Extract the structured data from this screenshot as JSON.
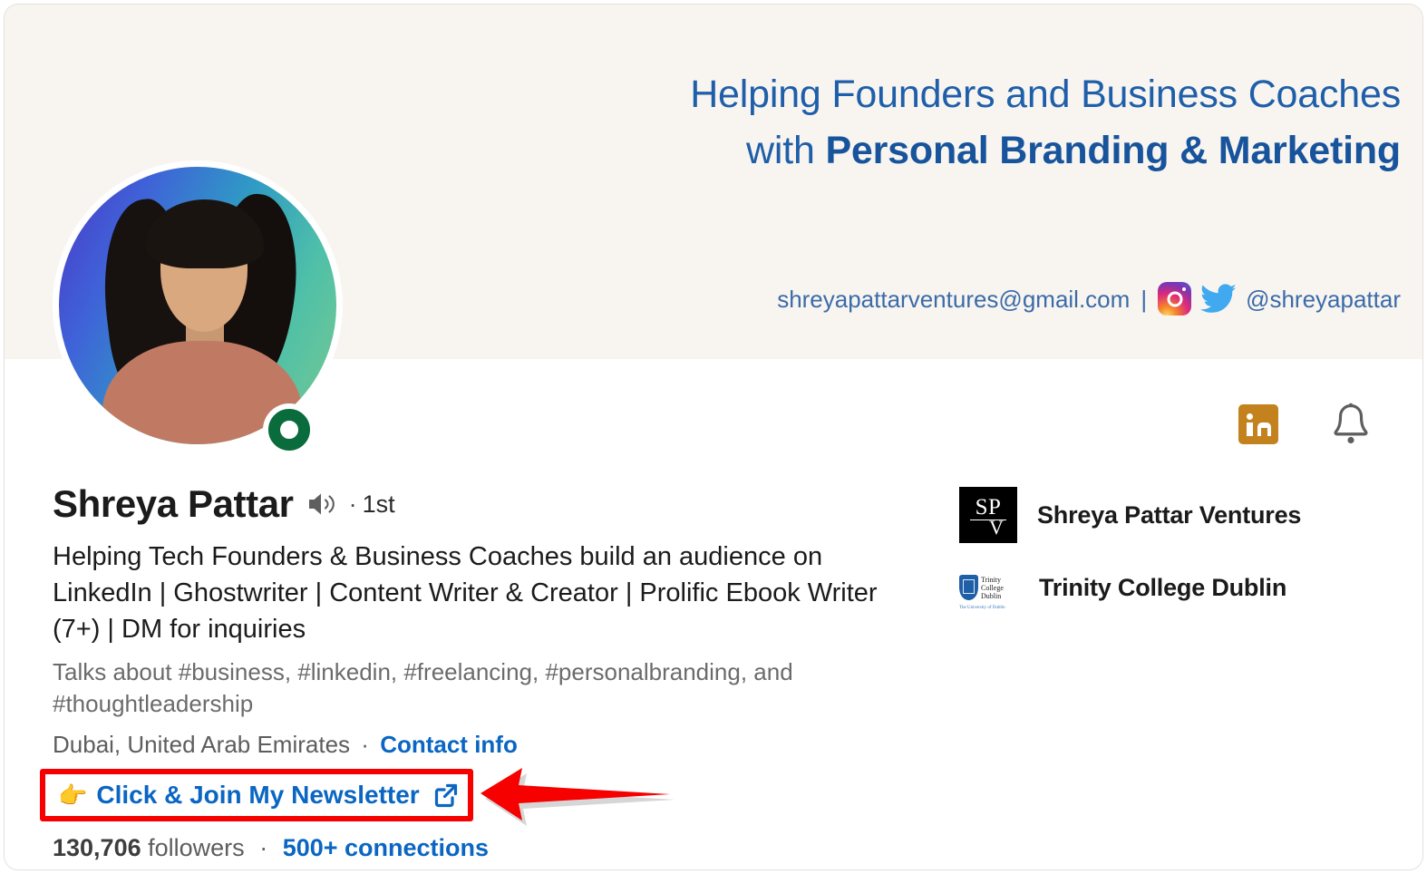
{
  "banner": {
    "headline_line1": "Helping Founders and Business Coaches",
    "headline_line2_prefix": "with ",
    "headline_line2_bold": "Personal Branding & Marketing",
    "email": "shreyapattarventures@gmail.com",
    "separator": "|",
    "social_handle": "@shreyapattar",
    "instagram_icon": "instagram-icon",
    "twitter_icon": "twitter-icon",
    "background_color": "#f8f5f1",
    "text_color": "#1f5fa9"
  },
  "avatar": {
    "alt": "profile-photo",
    "status_badge": "open-to-work-ring",
    "status_color": "#0a6b3d"
  },
  "top_icons": {
    "linkedin_badge": "linkedin-premium-badge",
    "linkedin_badge_color": "#c4821f",
    "notification_bell": "bell-icon"
  },
  "identity": {
    "name": "Shreya Pattar",
    "pronunciation_icon": "speaker-icon",
    "degree_dot": "·",
    "degree": "1st",
    "headline": "Helping Tech Founders & Business Coaches build an audience on LinkedIn | Ghostwriter | Content Writer & Creator | Prolific Ebook Writer (7+) | DM for inquiries",
    "talks_about": "Talks about #business, #linkedin, #freelancing, #personalbranding, and #thoughtleadership",
    "location": "Dubai, United Arab Emirates",
    "location_separator": "·",
    "contact_info_label": "Contact info"
  },
  "newsletter": {
    "emoji": "👉",
    "label": "Click & Join My Newsletter",
    "external_icon": "external-link-icon",
    "highlight_color": "#f60000",
    "link_color": "#0a66c2"
  },
  "annotation": {
    "arrow": "red-arrow-pointing-left",
    "arrow_color": "#f60000"
  },
  "stats": {
    "followers_count": "130,706",
    "followers_label": "followers",
    "separator": "·",
    "connections": "500+ connections"
  },
  "companies": [
    {
      "name": "Shreya Pattar Ventures",
      "logo": "spv-logo",
      "logo_text_top": "SP",
      "logo_text_bottom": "V"
    },
    {
      "name": "Trinity College Dublin",
      "logo": "trinity-college-dublin-logo",
      "logo_line1": "Trinity",
      "logo_line2": "College",
      "logo_line3": "Dublin",
      "logo_sub": "The University of Dublin"
    }
  ]
}
